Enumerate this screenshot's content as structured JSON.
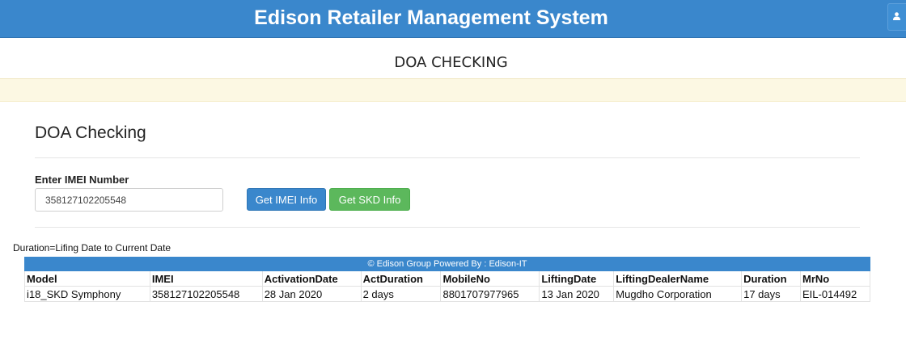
{
  "header": {
    "app_title": "Edison Retailer Management System",
    "user_icon": "user-icon"
  },
  "subheader": {
    "title": "DOA CHECKING"
  },
  "panel": {
    "title": "DOA Checking",
    "imei_label": "Enter IMEI Number",
    "imei_value": "358127102205548",
    "btn_imei": "Get IMEI Info",
    "btn_skd": "Get SKD Info"
  },
  "note": "Duration=Lifing Date to Current Date",
  "table": {
    "caption": "© Edison Group   Powered By :   Edison-IT",
    "columns": [
      "Model",
      "IMEI",
      "ActivationDate",
      "ActDuration",
      "MobileNo",
      "LiftingDate",
      "LiftingDealerName",
      "Duration",
      "MrNo"
    ],
    "rows": [
      [
        "i18_SKD Symphony",
        "358127102205548",
        "28 Jan 2020",
        "2 days",
        "8801707977965",
        "13 Jan 2020",
        "Mugdho Corporation",
        "17 days",
        "EIL-014492"
      ]
    ]
  },
  "colors": {
    "primary": "#3a87cc",
    "success": "#5cb85c",
    "alert_bg": "#fcf8e3"
  }
}
